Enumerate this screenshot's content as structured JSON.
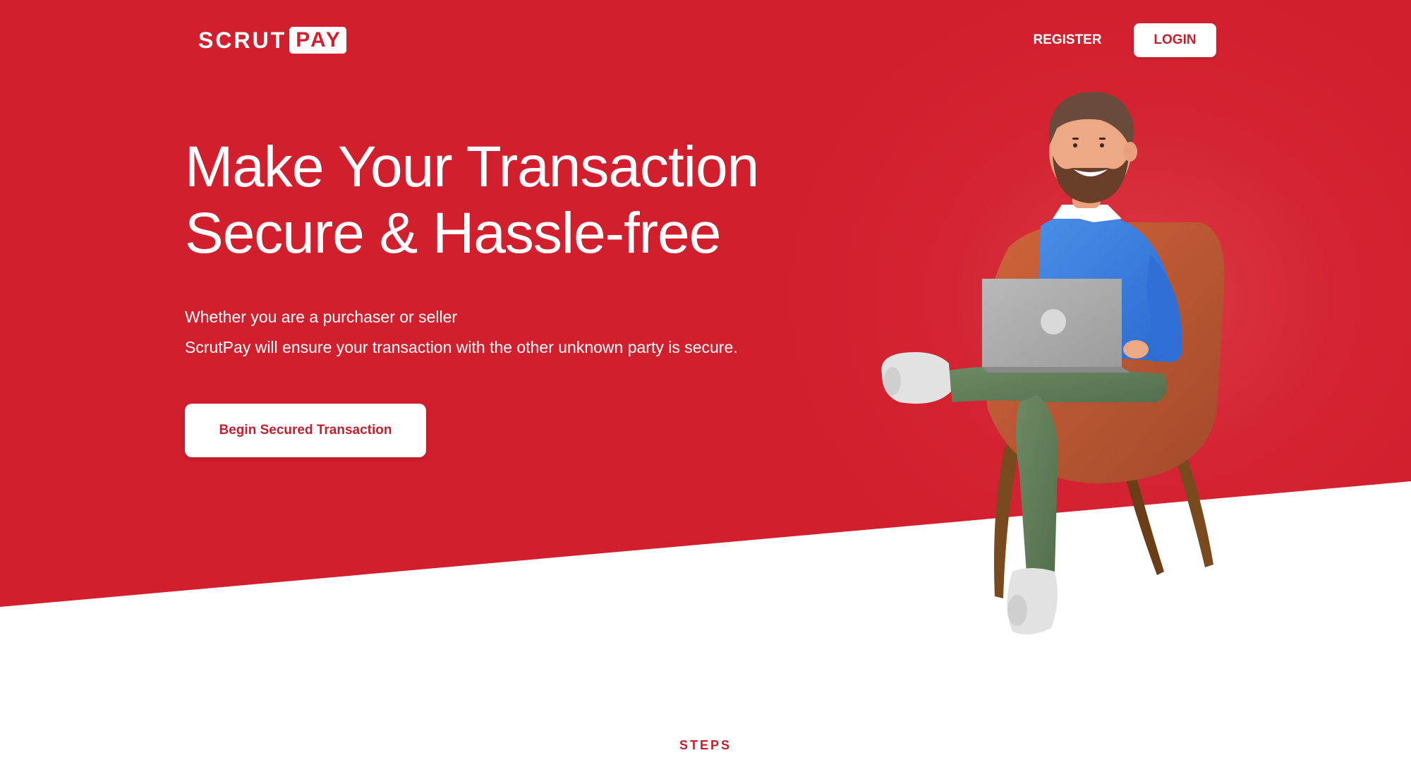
{
  "brand": {
    "logo_part1": "SCRUT",
    "logo_part2": "PAY",
    "primary_color": "#d21f2e",
    "button_text_color": "#c3202d"
  },
  "nav": {
    "register_label": "REGISTER",
    "login_label": "LOGIN"
  },
  "hero": {
    "title_line1": "Make Your Transaction",
    "title_line2": "Secure & Hassle-free",
    "subtitle_line1": "Whether you are a purchaser or seller",
    "subtitle_line2": "ScrutPay will ensure your transaction with the other unknown party is secure.",
    "cta_label": "Begin Secured Transaction",
    "illustration_icon": "man-sitting-with-laptop-illustration"
  },
  "sections": {
    "steps_label": "STEPS"
  }
}
